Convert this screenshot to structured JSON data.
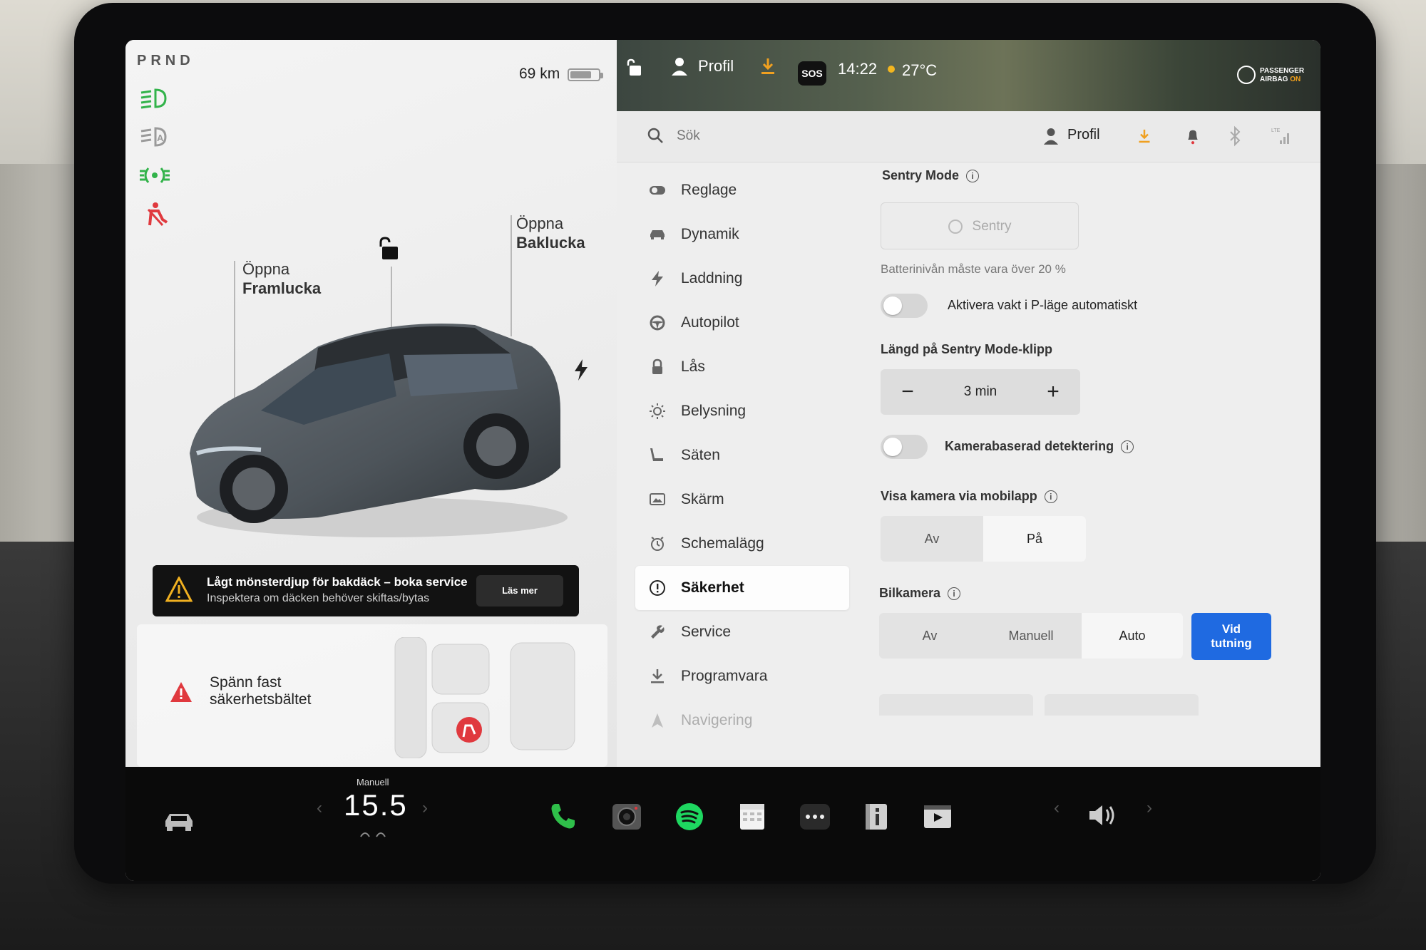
{
  "left_panel": {
    "gear": "PRND",
    "range": "69 km",
    "battery_level": 0.75,
    "open_frunk": [
      "Öppna",
      "Framlucka"
    ],
    "open_trunk": [
      "Öppna",
      "Baklucka"
    ],
    "alert": {
      "title": "Lågt mönsterdjup för bakdäck – boka service",
      "subtitle": "Inspektera om däcken behöver skiftas/bytas",
      "button": "Läs mer"
    },
    "seatbelt_warning": [
      "Spänn fast",
      "säkerhetsbältet"
    ]
  },
  "status_bar": {
    "profile": "Profil",
    "sos": "SOS",
    "time": "14:22",
    "temperature": "27°C",
    "airbag_line1": "PASSENGER",
    "airbag_line2": "AIRBAG",
    "airbag_state": "ON"
  },
  "header": {
    "search_placeholder": "Sök",
    "profile": "Profil"
  },
  "menu": [
    {
      "label": "Reglage",
      "icon": "toggle-icon"
    },
    {
      "label": "Dynamik",
      "icon": "car-icon"
    },
    {
      "label": "Laddning",
      "icon": "bolt-icon"
    },
    {
      "label": "Autopilot",
      "icon": "steering-wheel-icon"
    },
    {
      "label": "Lås",
      "icon": "lock-icon"
    },
    {
      "label": "Belysning",
      "icon": "sun-icon"
    },
    {
      "label": "Säten",
      "icon": "seat-icon"
    },
    {
      "label": "Skärm",
      "icon": "display-icon"
    },
    {
      "label": "Schemalägg",
      "icon": "clock-icon"
    },
    {
      "label": "Säkerhet",
      "icon": "shield-alert-icon",
      "active": true
    },
    {
      "label": "Service",
      "icon": "wrench-icon"
    },
    {
      "label": "Programvara",
      "icon": "download-icon"
    },
    {
      "label": "Navigering",
      "icon": "navigation-icon"
    }
  ],
  "settings": {
    "sentry_title": "Sentry Mode",
    "sentry_button": "Sentry",
    "battery_note": "Batterinivån måste vara över 20 %",
    "auto_guard_label": "Aktivera vakt i P-läge automatiskt",
    "auto_guard_on": false,
    "clip_length_title": "Längd på Sentry Mode-klipp",
    "clip_length_value": "3 min",
    "camera_detection_label": "Kamerabaserad detektering",
    "camera_detection_on": false,
    "mobile_camera_title": "Visa kamera via mobilapp",
    "mobile_camera_options": [
      "Av",
      "På"
    ],
    "mobile_camera_selected": "På",
    "dashcam_title": "Bilkamera",
    "dashcam_options": [
      "Av",
      "Manuell",
      "Auto"
    ],
    "dashcam_selected": "Auto",
    "dashcam_button": [
      "Vid",
      "tutning"
    ]
  },
  "taskbar": {
    "temp_mode": "Manuell",
    "temp_value": "15.5"
  },
  "colors": {
    "accent_blue": "#1f6ae1",
    "green_indicator": "#32b34a",
    "red_warning": "#e0393e",
    "orange_download": "#f0a020"
  }
}
